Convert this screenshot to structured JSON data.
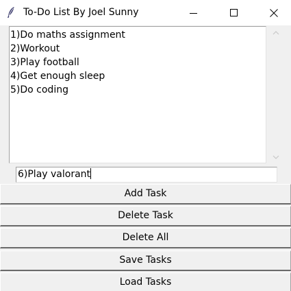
{
  "window": {
    "title": "To-Do List By Joel Sunny",
    "icon": "feather-icon"
  },
  "listbox": {
    "items": [
      "1)Do maths assignment",
      "2)Workout",
      "3)Play football",
      "4)Get enough sleep",
      "5)Do coding"
    ]
  },
  "entry": {
    "value": "6)Play valorant"
  },
  "buttons": {
    "add": "Add Task",
    "delete": "Delete Task",
    "delete_all": "Delete All",
    "save": "Save Tasks",
    "load": "Load Tasks"
  }
}
